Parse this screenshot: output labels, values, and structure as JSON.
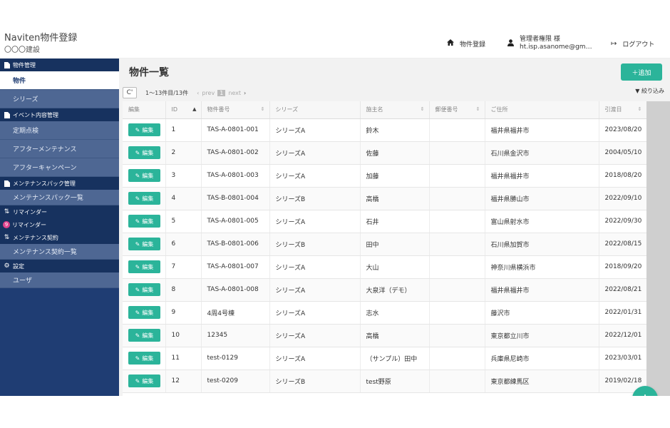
{
  "app": {
    "title": "Naviten物件登録",
    "company": "〇〇〇建設"
  },
  "header": {
    "property_register": "物件登録",
    "user_name": "管理者権限 様",
    "user_email": "ht.isp.asanome@gm…",
    "logout": "ログアウト"
  },
  "sidebar": {
    "sections": [
      {
        "label": "物件管理",
        "icon": "document-icon",
        "items": [
          "物件",
          "シリーズ"
        ]
      },
      {
        "label": "イベント内容管理",
        "icon": "document-icon",
        "items": [
          "定期点検",
          "アフターメンテナンス",
          "アフターキャンペーン"
        ]
      },
      {
        "label": "メンテナンスパック管理",
        "icon": "document-icon",
        "items": [
          "メンテナンスパック一覧"
        ]
      },
      {
        "label": "リマインダー",
        "icon": "sort-icon",
        "items": []
      },
      {
        "label": "リマインダー",
        "icon": "badge",
        "badge": "9",
        "items": []
      },
      {
        "label": "メンテナンス契約",
        "icon": "sort-icon",
        "items": [
          "メンテナンス契約一覧"
        ]
      },
      {
        "label": "設定",
        "icon": "gear-icon",
        "items": [
          "ユーザ"
        ]
      }
    ]
  },
  "main": {
    "page_title": "物件一覧",
    "add_label": "＋追加",
    "refresh_glyph": "C'",
    "range_text": "1～13件目/13件",
    "pager": {
      "prev": "prev",
      "page": "1",
      "next": "next"
    },
    "filter_label": "絞り込み",
    "columns": [
      "編集",
      "ID",
      "物件番号",
      "シリーズ",
      "施主名",
      "郵便番号",
      "ご住所",
      "引渡日"
    ],
    "edit_label": "編集",
    "rows": [
      {
        "id": "1",
        "no": "TAS-A-0801-001",
        "series": "シリーズA",
        "owner": "鈴木",
        "zip": "",
        "address": "福井県福井市",
        "date": "2023/08/20"
      },
      {
        "id": "2",
        "no": "TAS-A-0801-002",
        "series": "シリーズA",
        "owner": "佐藤",
        "zip": "",
        "address": "石川県金沢市",
        "date": "2004/05/10"
      },
      {
        "id": "3",
        "no": "TAS-A-0801-003",
        "series": "シリーズA",
        "owner": "加藤",
        "zip": "",
        "address": "福井県福井市",
        "date": "2018/08/20"
      },
      {
        "id": "4",
        "no": "TAS-B-0801-004",
        "series": "シリーズB",
        "owner": "高橋",
        "zip": "",
        "address": "福井県勝山市",
        "date": "2022/09/10"
      },
      {
        "id": "5",
        "no": "TAS-A-0801-005",
        "series": "シリーズA",
        "owner": "石井",
        "zip": "",
        "address": "富山県射水市",
        "date": "2022/09/30"
      },
      {
        "id": "6",
        "no": "TAS-B-0801-006",
        "series": "シリーズB",
        "owner": "田中",
        "zip": "",
        "address": "石川県加賀市",
        "date": "2022/08/15"
      },
      {
        "id": "7",
        "no": "TAS-A-0801-007",
        "series": "シリーズA",
        "owner": "大山",
        "zip": "",
        "address": "神奈川県横浜市",
        "date": "2018/09/20"
      },
      {
        "id": "8",
        "no": "TAS-A-0801-008",
        "series": "シリーズA",
        "owner": "大泉洋（デモ）",
        "zip": "",
        "address": "福井県福井市",
        "date": "2022/08/21"
      },
      {
        "id": "9",
        "no": "4周4号棟",
        "series": "シリーズA",
        "owner": "志水",
        "zip": "",
        "address": "藤沢市",
        "date": "2022/01/31"
      },
      {
        "id": "10",
        "no": "12345",
        "series": "シリーズA",
        "owner": "高橋",
        "zip": "",
        "address": "東京都立川市",
        "date": "2022/12/01"
      },
      {
        "id": "11",
        "no": "test-0129",
        "series": "シリーズA",
        "owner": "（サンプル）田中",
        "zip": "",
        "address": "兵庫県尼崎市",
        "date": "2023/03/01"
      },
      {
        "id": "12",
        "no": "test-0209",
        "series": "シリーズB",
        "owner": "test野原",
        "zip": "",
        "address": "東京都練馬区",
        "date": "2019/02/18"
      }
    ]
  },
  "fab_label": "+",
  "colors": {
    "sidebar": "#1f3d73",
    "accent": "#2bb49a",
    "badge": "#e0428c"
  }
}
